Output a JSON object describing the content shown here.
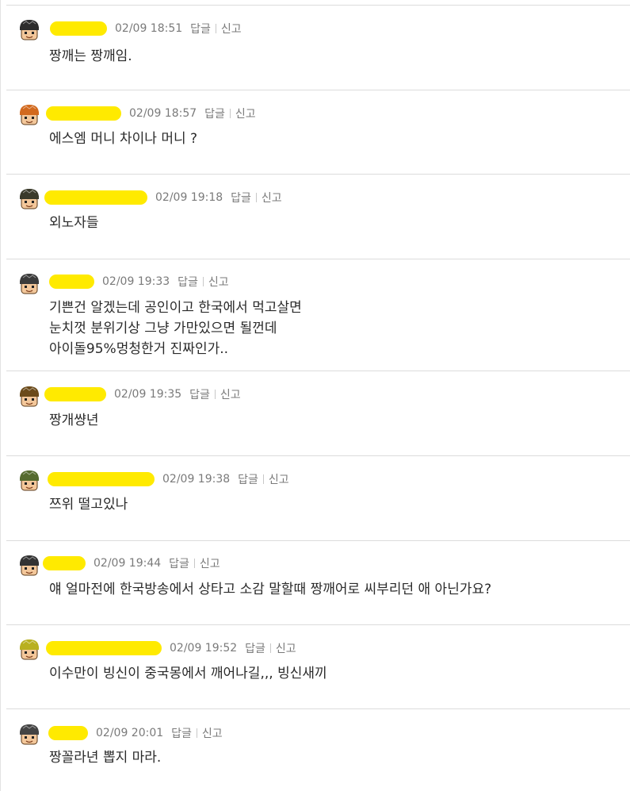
{
  "comments": [
    {
      "name": "",
      "time": "02/09 18:51",
      "reply_label": "답글",
      "report_label": "신고",
      "text": "짱깨는 짱깨임."
    },
    {
      "name": "",
      "time": "02/09 18:57",
      "reply_label": "답글",
      "report_label": "신고",
      "text": "에스엠 머니 차이나 머니 ?"
    },
    {
      "name": "",
      "time": "02/09 19:18",
      "reply_label": "답글",
      "report_label": "신고",
      "text": "외노자들"
    },
    {
      "name": "",
      "time": "02/09 19:33",
      "reply_label": "답글",
      "report_label": "신고",
      "text": "기쁜건 알겠는데 공인이고 한국에서 먹고살면\n눈치껏 분위기상 그냥 가만있으면 될껀데\n아이돌95%멍청한거 진짜인가.."
    },
    {
      "name": "",
      "time": "02/09 19:35",
      "reply_label": "답글",
      "report_label": "신고",
      "text": "짱개썅년"
    },
    {
      "name": "",
      "time": "02/09 19:38",
      "reply_label": "답글",
      "report_label": "신고",
      "text": "쯔위 떨고있나"
    },
    {
      "name": "",
      "time": "02/09 19:44",
      "reply_label": "답글",
      "report_label": "신고",
      "text": "얘 얼마전에 한국방송에서 상타고 소감 말할때 짱깨어로 씨부리던 애 아닌가요?"
    },
    {
      "name": "",
      "time": "02/09 19:52",
      "reply_label": "답글",
      "report_label": "신고",
      "text": "이수만이 빙신이 중국몽에서 깨어나길,,, 빙신새끼"
    },
    {
      "name": "",
      "time": "02/09 20:01",
      "reply_label": "답글",
      "report_label": "신고",
      "text": "짱꼴라년 뽑지 마라."
    }
  ],
  "colors": {
    "avatar_hair": [
      "#2d2d2d",
      "#d2691e",
      "#3a3a2a",
      "#3b3b3b",
      "#6b4a1a",
      "#556b2f",
      "#333333",
      "#b8b020",
      "#444444"
    ],
    "mask": "#ffea00",
    "meta_text": "#7a7a7a",
    "body_text": "#2a2a2a"
  }
}
